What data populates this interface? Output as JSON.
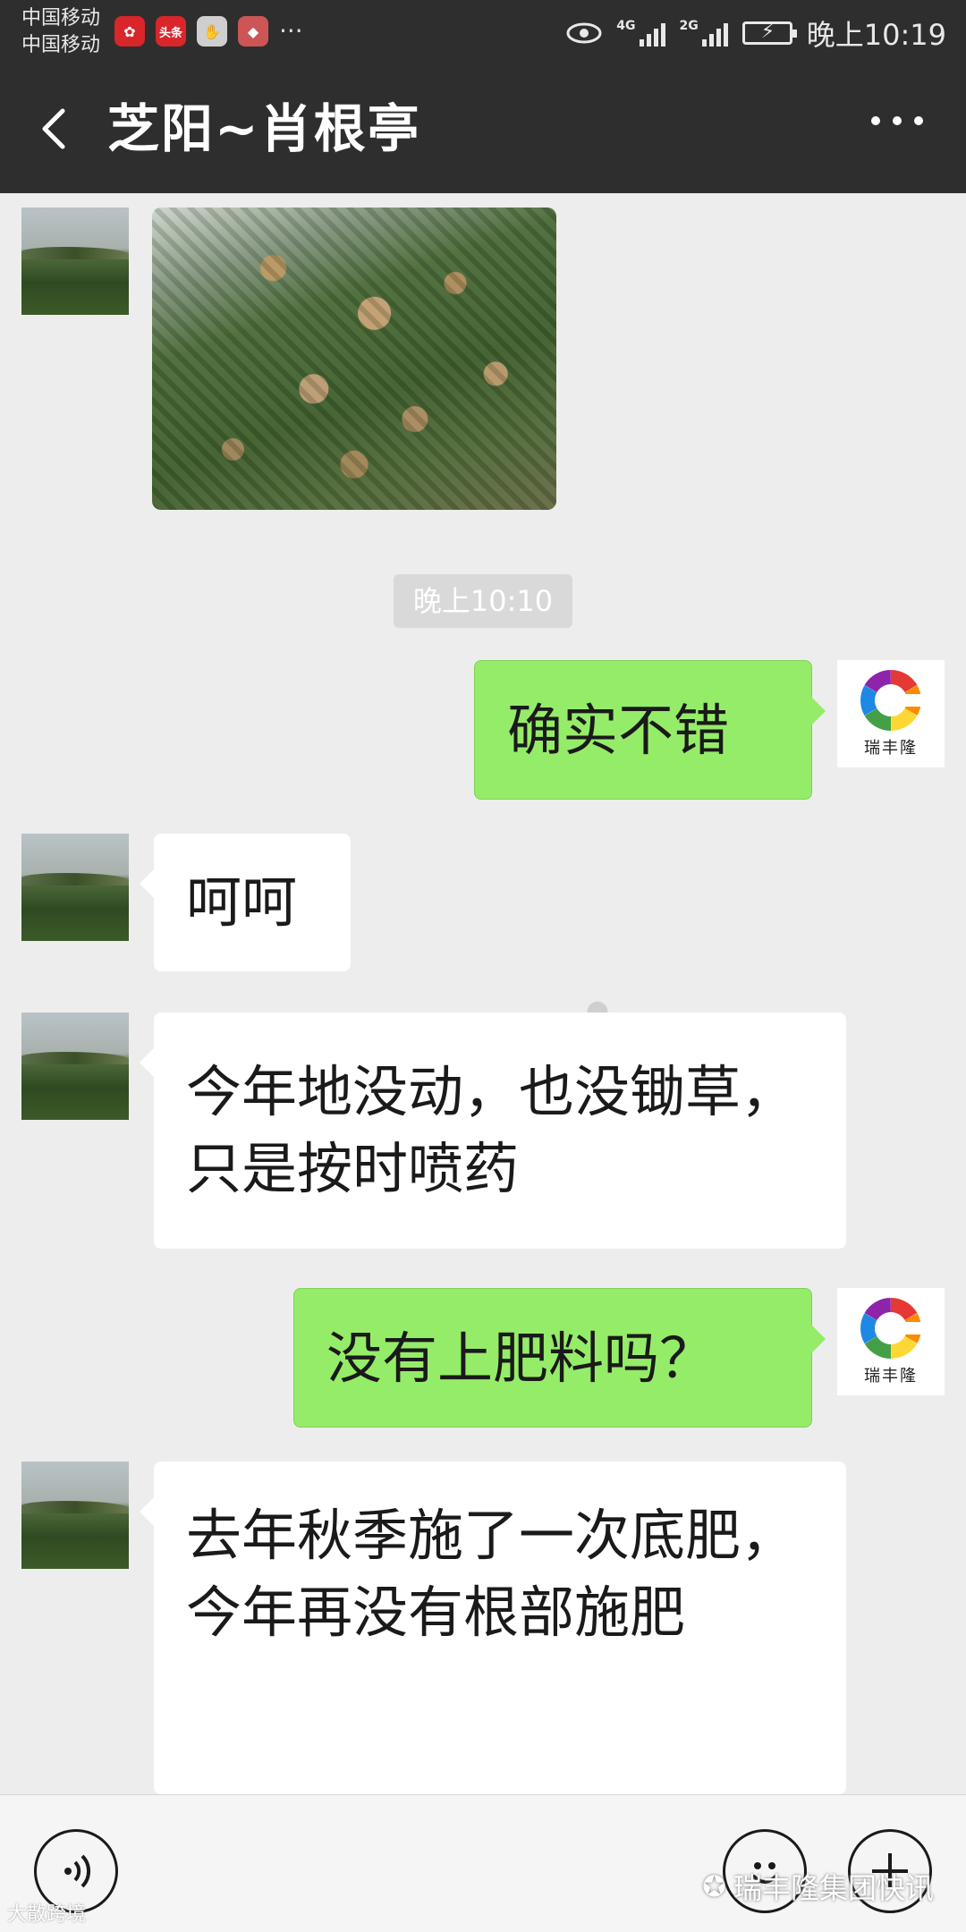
{
  "status_bar": {
    "carrier_1": "中国移动",
    "carrier_2": "中国移动",
    "more_notifications": "···",
    "network_1": "4G",
    "network_2": "2G",
    "time": "晚上10:19",
    "notification_icons": [
      "chat-icon",
      "huawei-icon",
      "toutiao-icon",
      "hand-icon",
      "app-icon"
    ],
    "toutiao_label": "头条"
  },
  "header": {
    "title": "芝阳~肖根亭",
    "back_icon": "chevron-left-icon",
    "more_icon": "more-dots-icon"
  },
  "chat": {
    "timestamp": "晚上10:10",
    "messages": [
      {
        "from": "other",
        "type": "image"
      },
      {
        "from": "me",
        "text": "确实不错"
      },
      {
        "from": "other",
        "text": "呵呵"
      },
      {
        "from": "other",
        "text": "今年地没动，也没锄草，只是按时喷药"
      },
      {
        "from": "me",
        "text": "没有上肥料吗？"
      },
      {
        "from": "other",
        "text": "去年秋季施了一次底肥，今年再没有根部施肥"
      }
    ],
    "my_avatar_text": "瑞丰隆",
    "my_avatar_mark": "®"
  },
  "input_bar": {
    "voice_icon": "voice-icon",
    "emoji_icon": "emoji-icon",
    "plus_icon": "plus-icon"
  },
  "watermarks": {
    "left": "大散跨境",
    "right": "瑞丰隆集团快讯"
  },
  "colors": {
    "header_bg": "#2e2e2e",
    "chat_bg": "#ededed",
    "out_bubble": "#95ec69",
    "in_bubble": "#ffffff"
  }
}
